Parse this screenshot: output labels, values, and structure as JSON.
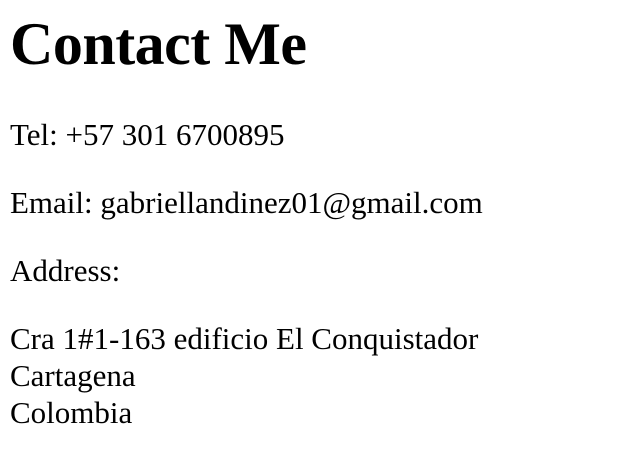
{
  "heading": "Contact Me",
  "tel": "Tel: +57 301 6700895",
  "email": "Email: gabriellandinez01@gmail.com",
  "address_label": "Address:",
  "address_lines": [
    "Cra 1#1-163 edificio El Conquistador",
    "Cartagena",
    "Colombia"
  ]
}
